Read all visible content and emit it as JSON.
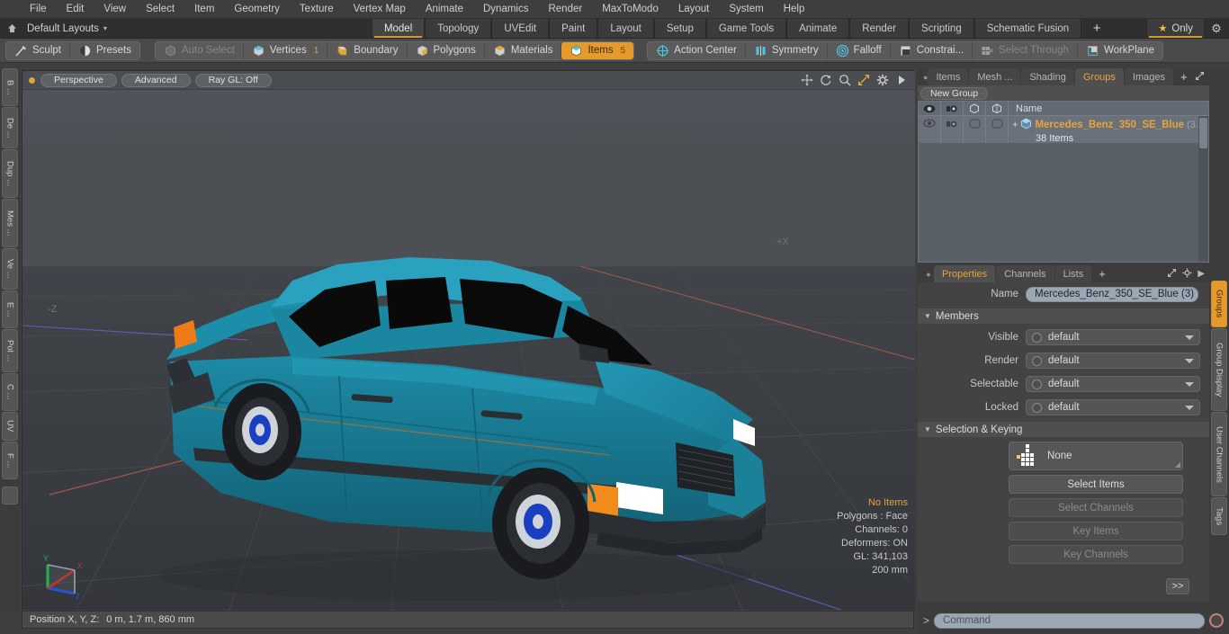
{
  "menu": {
    "items": [
      "File",
      "Edit",
      "View",
      "Select",
      "Item",
      "Geometry",
      "Texture",
      "Vertex Map",
      "Animate",
      "Dynamics",
      "Render",
      "MaxToModo",
      "Layout",
      "System",
      "Help"
    ]
  },
  "layoutbar": {
    "home_icon": "home-icon",
    "layout_name": "Default Layouts",
    "caret": "▾",
    "tabs": [
      {
        "label": "Model",
        "active": true
      },
      {
        "label": "Topology",
        "active": false
      },
      {
        "label": "UVEdit",
        "active": false
      },
      {
        "label": "Paint",
        "active": false
      },
      {
        "label": "Layout",
        "active": false
      },
      {
        "label": "Setup",
        "active": false
      },
      {
        "label": "Game Tools",
        "active": false
      },
      {
        "label": "Animate",
        "active": false
      },
      {
        "label": "Render",
        "active": false
      },
      {
        "label": "Scripting",
        "active": false
      },
      {
        "label": "Schematic Fusion",
        "active": false
      }
    ],
    "add_label": "+",
    "only_label": "Only",
    "star_glyph": "★",
    "gear_glyph": "⚙"
  },
  "toolbar": {
    "left_group": [
      {
        "label": "Sculpt",
        "icon": "sculpt-brush-icon",
        "state": "normal"
      },
      {
        "label": "Presets",
        "icon": "presets-sphere-icon",
        "state": "normal"
      }
    ],
    "select_group": [
      {
        "label": "Auto Select",
        "icon": "auto-select-icon",
        "state": "dim",
        "count": ""
      },
      {
        "label": "Vertices",
        "icon": "vertices-icon",
        "state": "normal",
        "count": "1"
      },
      {
        "label": "Boundary",
        "icon": "boundary-icon",
        "state": "normal",
        "count": ""
      },
      {
        "label": "Polygons",
        "icon": "polygons-icon",
        "state": "normal",
        "count": ""
      },
      {
        "label": "Materials",
        "icon": "materials-icon",
        "state": "normal",
        "count": ""
      },
      {
        "label": "Items",
        "icon": "items-icon",
        "state": "selected",
        "count": "5"
      }
    ],
    "right_group": [
      {
        "label": "Action Center",
        "icon": "action-center-icon",
        "state": "normal"
      },
      {
        "label": "Symmetry",
        "icon": "symmetry-icon",
        "state": "normal"
      },
      {
        "label": "Falloff",
        "icon": "falloff-icon",
        "state": "normal"
      },
      {
        "label": "Constrai...",
        "icon": "constraint-icon",
        "state": "normal"
      },
      {
        "label": "Select Through",
        "icon": "select-through-icon",
        "state": "dim"
      },
      {
        "label": "WorkPlane",
        "icon": "workplane-icon",
        "state": "normal"
      }
    ]
  },
  "left_rail": {
    "tabs": [
      "B ...",
      "De ...",
      "Dup ...",
      "Mes ...",
      "Ve ...",
      "E ...",
      "Pol ...",
      "C ...",
      "UV",
      "F ..."
    ]
  },
  "viewport": {
    "dot_color": "#e0a23a",
    "pills": [
      "Perspective",
      "Advanced",
      "Ray GL: Off"
    ],
    "nav_icons": [
      "pan-icon",
      "rotate-icon",
      "zoom-icon",
      "maximize-icon",
      "gear-icon",
      "play-arrow-icon"
    ],
    "axis_labels": {
      "left": "-Z",
      "right": "+X"
    },
    "stats": {
      "selection": "No Items",
      "polygons": "Polygons : Face",
      "channels": "Channels: 0",
      "deformers": "Deformers: ON",
      "gl": "GL: 341,103",
      "grid": "200 mm"
    },
    "gizmo": {
      "x": "X",
      "y": "Y",
      "z": "Z"
    },
    "model": {
      "body_color": "#1b84a0",
      "body_color_light": "#2296b4",
      "body_color_dark": "#126076",
      "glass_color": "#0a0a0a",
      "trim_color": "#2e3034",
      "indicator_color": "#ec7b18",
      "headlight_color": "#ffffff",
      "rim_color": "#1a3fc0"
    }
  },
  "statusbar": {
    "label": "Position X, Y, Z:",
    "value": "0 m, 1.7 m, 860 mm"
  },
  "right_panel": {
    "top_tabs": [
      {
        "label": "Items",
        "active": false
      },
      {
        "label": "Mesh ...",
        "active": false
      },
      {
        "label": "Shading",
        "active": false
      },
      {
        "label": "Groups",
        "active": true
      },
      {
        "label": "Images",
        "active": false
      }
    ],
    "top_tabs_plus": "+",
    "new_group_label": "New Group",
    "list": {
      "columns": [
        "eye-icon",
        "render-icon",
        "selectable-icon",
        "lock-icon"
      ],
      "name_header": "Name",
      "rows": [
        {
          "expander": "+",
          "icon": "group-item-icon",
          "title": "Mercedes_Benz_350_SE_Blue",
          "suffix": "(3...",
          "subtitle": "38 Items"
        }
      ]
    },
    "props_tabs": [
      {
        "label": "Properties",
        "active": true
      },
      {
        "label": "Channels",
        "active": false
      },
      {
        "label": "Lists",
        "active": false
      }
    ],
    "props_tabs_plus": "+",
    "name_label": "Name",
    "name_value": "Mercedes_Benz_350_SE_Blue (3)",
    "members_section": "Members",
    "members": [
      {
        "label": "Visible",
        "value": "default"
      },
      {
        "label": "Render",
        "value": "default"
      },
      {
        "label": "Selectable",
        "value": "default"
      },
      {
        "label": "Locked",
        "value": "default"
      }
    ],
    "selection_section": "Selection & Keying",
    "selection_dropdown": "None",
    "selection_buttons": [
      {
        "label": "Select Items",
        "enabled": true
      },
      {
        "label": "Select Channels",
        "enabled": false
      },
      {
        "label": "Key Items",
        "enabled": false
      },
      {
        "label": "Key Channels",
        "enabled": false
      }
    ],
    "more_button": ">>",
    "right_rail_tabs": [
      {
        "label": "Groups",
        "active": true
      },
      {
        "label": "Group Display",
        "active": false
      },
      {
        "label": "User Channels",
        "active": false
      },
      {
        "label": "Tags",
        "active": false
      }
    ]
  },
  "command_bar": {
    "prompt": ">",
    "placeholder": "Command",
    "record_icon": "record-icon"
  }
}
